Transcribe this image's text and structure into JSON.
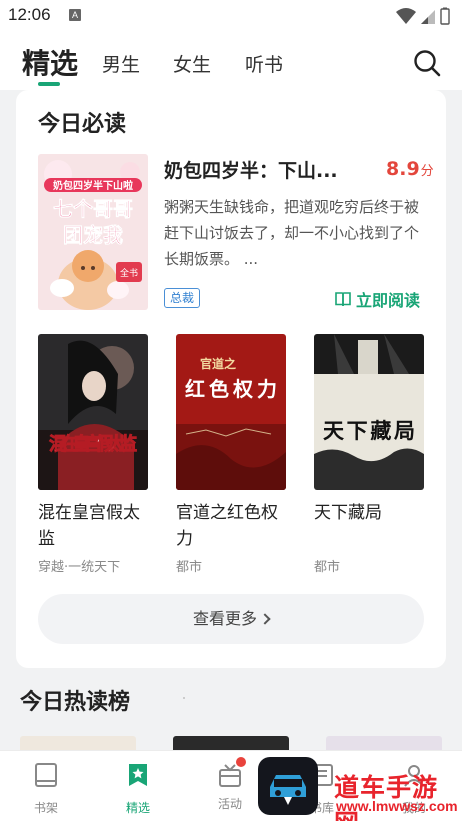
{
  "status_bar": {
    "time": "12:06",
    "notification_letter": "A"
  },
  "header": {
    "tabs": [
      {
        "label": "精选",
        "active": true
      },
      {
        "label": "男生",
        "active": false
      },
      {
        "label": "女生",
        "active": false
      },
      {
        "label": "听书",
        "active": false
      }
    ],
    "search_icon": "search-icon"
  },
  "daily": {
    "title": "今日必读",
    "featured": {
      "title": "奶包四岁半：下山...",
      "score": "8.9",
      "score_unit": "分",
      "description": "粥粥天生缺钱命，把道观吃穷后终于被赶下山讨饭去了，却一不小心找到了个长期饭票。 ...",
      "tag": "总裁",
      "read_label": "立即阅读",
      "cover_text": {
        "top": "奶包四岁半下山啦",
        "main1": "七个哥哥",
        "main2": "团宠我",
        "badge": "全书"
      }
    },
    "books": [
      {
        "title": "混在皇宫假太监",
        "category": "穿越·一统天下",
        "cover_text": "混在皇宫假太监"
      },
      {
        "title": "官道之红色权力",
        "category": "都市",
        "cover_text_top": "官道之",
        "cover_text": "红色权力"
      },
      {
        "title": "天下藏局",
        "category": "都市",
        "cover_text": "天下藏局"
      }
    ],
    "more_label": "查看更多"
  },
  "hot": {
    "title": "今日热读榜"
  },
  "bottom_nav": {
    "items": [
      {
        "label": "书架",
        "icon": "bookshelf-icon"
      },
      {
        "label": "精选",
        "icon": "featured-icon",
        "active": true
      },
      {
        "label": "活动",
        "icon": "gift-icon",
        "badge": true
      },
      {
        "label": "书库",
        "icon": "library-icon"
      },
      {
        "label": "我的",
        "icon": "profile-icon"
      }
    ]
  },
  "watermark": {
    "text": "道车手游网",
    "url": "www.lmwwsz.com"
  },
  "colors": {
    "accent": "#19a576",
    "score": "#e3463c",
    "tag": "#2f7fd0",
    "badge": "#e9433c"
  }
}
